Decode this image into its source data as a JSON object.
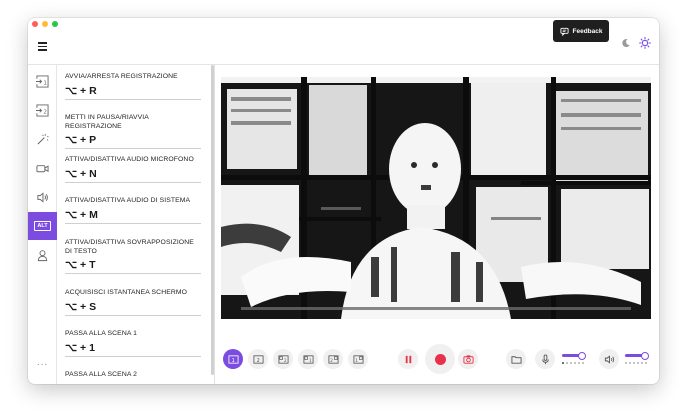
{
  "feedback": {
    "label": "Feedback"
  },
  "theme": {
    "icons": [
      "moon-icon",
      "sun-icon"
    ],
    "accent": "#7c4ce0"
  },
  "rail": {
    "items": [
      {
        "name": "source-1-icon"
      },
      {
        "name": "source-2-icon"
      },
      {
        "name": "effects-icon"
      },
      {
        "name": "camera-icon"
      },
      {
        "name": "speaker-icon"
      },
      {
        "name": "alt-shortcuts-icon",
        "label": "ALT",
        "active": true
      },
      {
        "name": "user-icon"
      }
    ],
    "more": "..."
  },
  "shortcuts": [
    {
      "label": "AVVIA/ARRESTA REGISTRAZIONE",
      "keys": "⌥ + R"
    },
    {
      "label": "METTI IN PAUSA/RIAVVIA REGISTRAZIONE",
      "keys": "⌥ + P"
    },
    {
      "label": "ATTIVA/DISATTIVA AUDIO MICROFONO",
      "keys": "⌥ + N"
    },
    {
      "label": "ATTIVA/DISATTIVA AUDIO DI SISTEMA",
      "keys": "⌥ + M"
    },
    {
      "label": "ATTIVA/DISATTIVA SOVRAPPOSIZIONE DI TESTO",
      "keys": "⌥ + T"
    },
    {
      "label": "ACQUISISCI ISTANTANEA SCHERMO",
      "keys": "⌥ + S"
    },
    {
      "label": "PASSA ALLA SCENA 1",
      "keys": "⌥ + 1"
    },
    {
      "label": "PASSA ALLA SCENA 2",
      "keys": ""
    }
  ],
  "controls": {
    "scenes": [
      "1",
      "2",
      "2",
      "1",
      "2",
      "1"
    ],
    "active_scene": 0,
    "record_color": "#e8314a",
    "mic_level": 0.9,
    "speaker_level": 0.9
  }
}
